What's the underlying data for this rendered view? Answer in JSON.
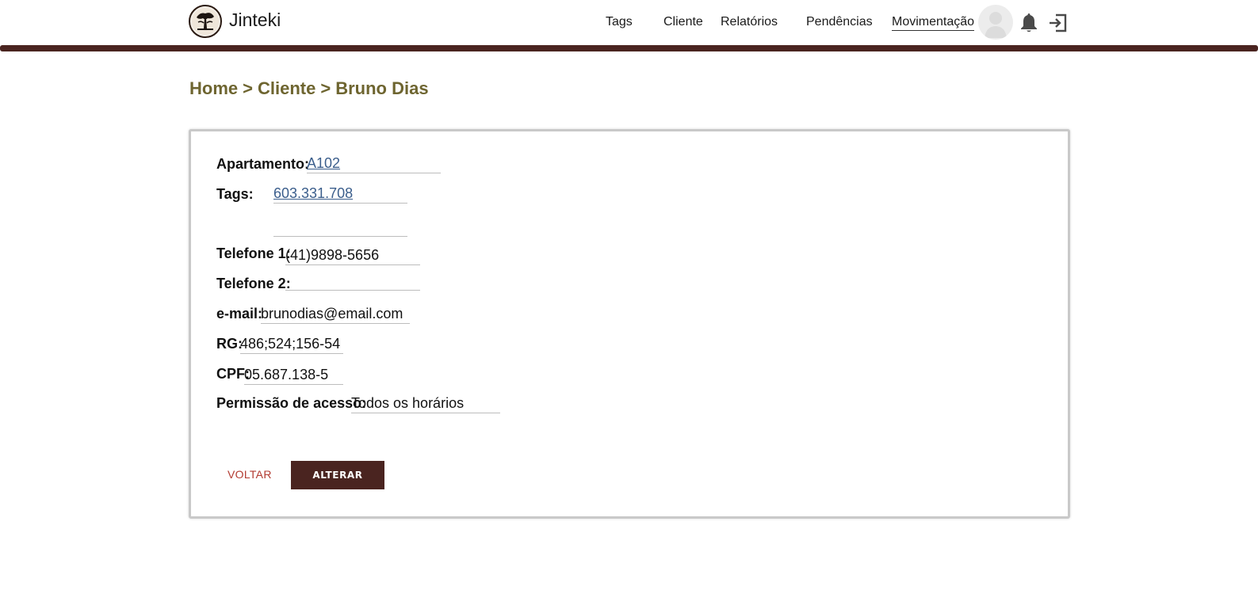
{
  "header": {
    "app_title": "Jinteki",
    "logo_icon": "tree-logo-icon",
    "nav": [
      {
        "label": "Tags"
      },
      {
        "label": "Cliente"
      },
      {
        "label": "Relatórios"
      },
      {
        "label": "Pendências"
      },
      {
        "label": "Movimentação"
      }
    ],
    "accent_color": "#4a2420"
  },
  "breadcrumb": {
    "home": "Home",
    "separator": ">",
    "section": "Cliente",
    "current": "Bruno Dias"
  },
  "client": {
    "apartamento_label": "Apartamento:",
    "apartamento_value": "A102",
    "tags_label": "Tags:",
    "tags_values": [
      "603.331.708",
      ""
    ],
    "telefone1_label": "Telefone 1:",
    "telefone1_value": "(41)9898-5656",
    "telefone2_label": "Telefone 2:",
    "telefone2_value": "",
    "email_label": "e-mail:",
    "email_value": "brunodias@email.com",
    "rg_label": "RG:",
    "rg_value": "486;524;156-54",
    "cpf_label": "CPF:",
    "cpf_value": "05.687.138-5",
    "permissao_label": "Permissão de acesso:",
    "permissao_value": "Todos os horários"
  },
  "actions": {
    "voltar_label": "VOLTAR",
    "alterar_label": "ALTERAR"
  }
}
